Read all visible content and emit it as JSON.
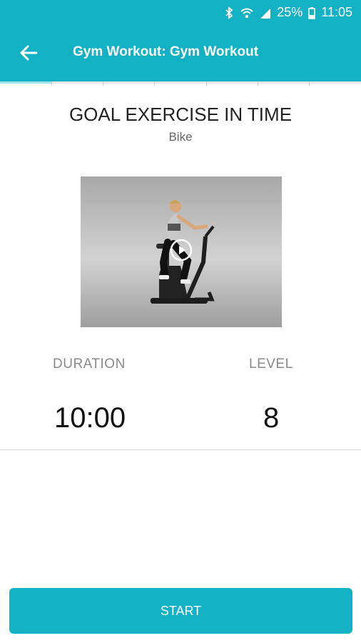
{
  "status": {
    "battery": "25%",
    "time": "11:05"
  },
  "header": {
    "title": "Gym Workout: Gym Workout"
  },
  "exercise": {
    "goal": "GOAL EXERCISE IN TIME",
    "machine": "Bike"
  },
  "stats": {
    "duration_label": "DURATION",
    "duration_value": "10:00",
    "level_label": "LEVEL",
    "level_value": "8"
  },
  "actions": {
    "start_label": "START"
  },
  "colors": {
    "accent": "#13b1c4"
  }
}
